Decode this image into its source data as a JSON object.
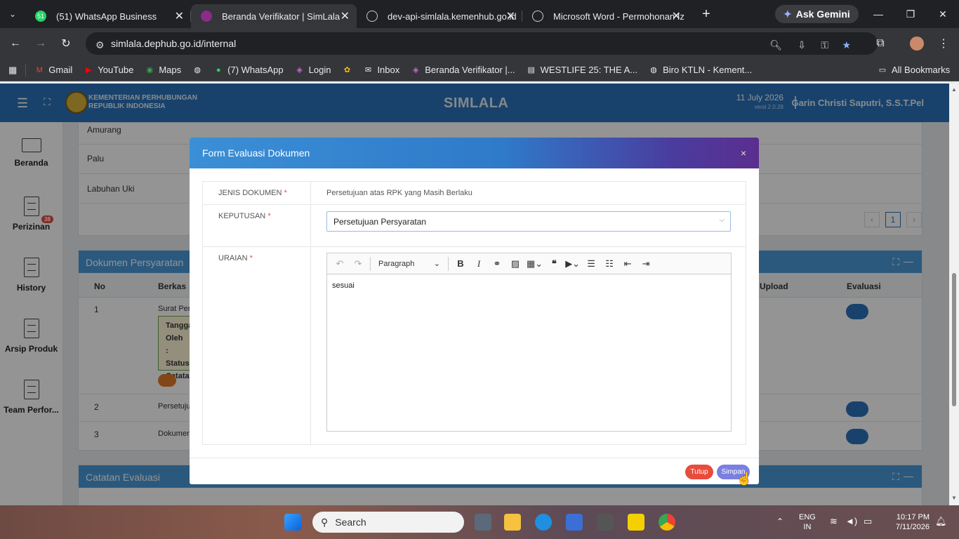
{
  "browser": {
    "tabs": [
      {
        "title": "(51) WhatsApp Business",
        "favicon_text": "51"
      },
      {
        "title": "Beranda Verifikator | SimLala",
        "favicon_text": ""
      },
      {
        "title": "dev-api-simlala.kemenhub.go.id",
        "favicon_text": ""
      },
      {
        "title": "Microsoft Word - Permohonan Iz",
        "favicon_text": ""
      }
    ],
    "active_tab_index": 1,
    "gemini_label": "Ask Gemini",
    "url": "simlala.dephub.go.id/internal",
    "bookmarks": [
      {
        "label": "Gmail",
        "icon": "gmail-icon"
      },
      {
        "label": "YouTube",
        "icon": "youtube-icon"
      },
      {
        "label": "Maps",
        "icon": "maps-icon"
      },
      {
        "label": "",
        "icon": "globe-icon"
      },
      {
        "label": "(7) WhatsApp",
        "icon": "whatsapp-icon"
      },
      {
        "label": "Login",
        "icon": "simlala-icon"
      },
      {
        "label": "",
        "icon": "photos-icon"
      },
      {
        "label": "Inbox",
        "icon": "inbox-icon"
      },
      {
        "label": "Beranda Verifikator |...",
        "icon": "simlala-icon"
      },
      {
        "label": "WESTLIFE 25: THE A...",
        "icon": "table-icon"
      },
      {
        "label": "Biro KTLN - Kement...",
        "icon": "globe-icon"
      }
    ],
    "all_bookmarks_label": "All Bookmarks"
  },
  "header": {
    "org_line1": "KEMENTERIAN PERHUBUNGAN",
    "org_line2": "REPUBLIK INDONESIA",
    "app_title": "SIMLALA",
    "date": "11 July 2026",
    "version": "versi 2.0.28",
    "user": "Garin Christi Saputri, S.S.T.Pel"
  },
  "sidebar": {
    "items": [
      {
        "label": "Beranda",
        "icon": "monitor-icon"
      },
      {
        "label": "Perizinan",
        "icon": "document-icon",
        "badge": "38"
      },
      {
        "label": "History",
        "icon": "document-icon"
      },
      {
        "label": "Arsip Produk",
        "icon": "document-icon"
      },
      {
        "label": "Team Perfor...",
        "icon": "document-icon"
      }
    ]
  },
  "background": {
    "locations": [
      "Amurang",
      "Palu",
      "Labuhan Uki"
    ],
    "pagination_current": "1",
    "dokumen_title": "Dokumen Persyaratan",
    "columns": [
      "No",
      "Berkas",
      "Upload",
      "Evaluasi"
    ],
    "rows": [
      {
        "no": "1",
        "berkas": "Surat Pen"
      },
      {
        "no": "2",
        "berkas": "Persetuju"
      },
      {
        "no": "3",
        "berkas": "Dokumen"
      }
    ],
    "info_box": [
      "Tangga",
      "Oleh :",
      "Status",
      "Catatan"
    ],
    "catatan_title": "Catatan Evaluasi"
  },
  "modal": {
    "title": "Form Evaluasi Dokumen",
    "close": "×",
    "fields": {
      "jenis_label": "JENIS DOKUMEN",
      "jenis_value": "Persetujuan atas RPK yang Masih Berlaku",
      "keputusan_label": "KEPUTUSAN",
      "keputusan_value": "Persetujuan Persyaratan",
      "uraian_label": "URAIAN",
      "uraian_value": "sesuai",
      "required_mark": "*"
    },
    "editor": {
      "paragraph_label": "Paragraph"
    },
    "buttons": {
      "tutup": "Tutup",
      "simpan": "Simpan"
    }
  },
  "taskbar": {
    "search_placeholder": "Search",
    "lang_line1": "ENG",
    "lang_line2": "IN",
    "time": "10:17 PM",
    "date": "7/11/2026"
  },
  "colors": {
    "header_blue": "#2a73b8",
    "card_head_blue": "#4b9ad9",
    "tutup_red": "#e74c3c",
    "simpan_purple": "#7b7fe0"
  }
}
